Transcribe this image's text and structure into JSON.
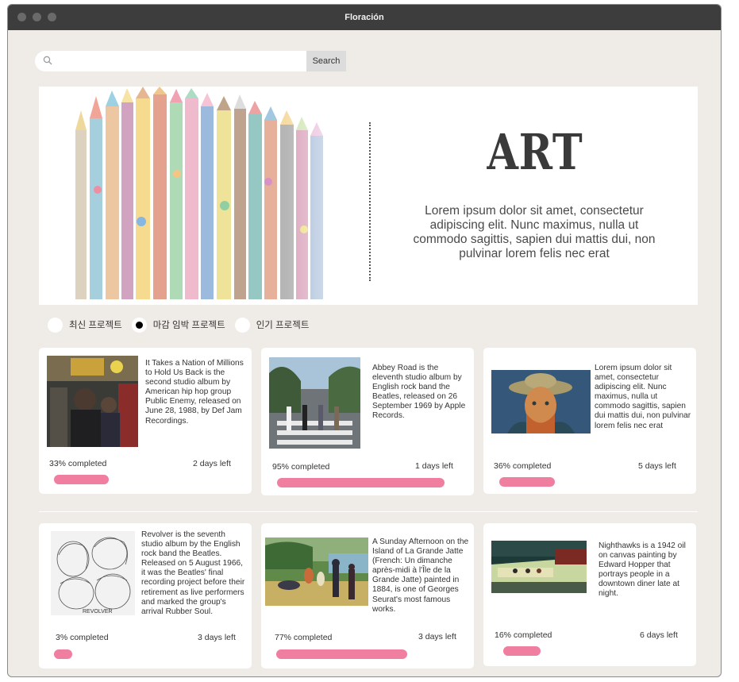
{
  "window": {
    "title": "Floración"
  },
  "search": {
    "placeholder": "",
    "button_label": "Search"
  },
  "hero": {
    "title": "ART",
    "text": "Lorem ipsum dolor sit amet, consectetur adipiscing elit. Nunc maximus, nulla ut commodo sagittis, sapien dui mattis dui, non pulvinar lorem felis nec erat"
  },
  "filters": [
    {
      "label": "최신 프로젝트",
      "checked": false
    },
    {
      "label": "마감 임박 프로젝트",
      "checked": true
    },
    {
      "label": "인기 프로젝트",
      "checked": false
    }
  ],
  "cards": [
    {
      "description": "It Takes a Nation of Millions to Hold Us Back is the second studio album by American hip hop group Public Enemy, released on June 28, 1988, by Def Jam Recordings.",
      "completed_label": "33% completed",
      "progress": 0.33,
      "days_left": "2 days left",
      "image": "album-cover-public-enemy"
    },
    {
      "description": "Abbey Road is the eleventh studio album by English rock band the Beatles, released on 26 September 1969 by Apple Records.",
      "completed_label": "95% completed",
      "progress": 0.95,
      "days_left": "1 days left",
      "image": "album-cover-abbey-road"
    },
    {
      "description": "Lorem ipsum dolor sit amet, consectetur adipiscing elit. Nunc maximus, nulla ut commodo sagittis, sapien dui mattis dui, non pulvinar lorem felis nec erat",
      "completed_label": "36% completed",
      "progress": 0.36,
      "days_left": "5 days left",
      "image": "painting-van-gogh-self-portrait"
    },
    {
      "description": "Revolver is the seventh studio album by the English rock band the Beatles. Released on 5 August 1966, it was the Beatles' final recording project before their retirement as live performers and marked the group's arrival Rubber Soul.",
      "completed_label": "3% completed",
      "progress": 0.03,
      "days_left": "3 days left",
      "image": "album-cover-revolver",
      "cover_text": "REVOLVER"
    },
    {
      "description": "A Sunday Afternoon on the Island of La Grande Jatte (French: Un dimanche après-midi à l'Île de la Grande Jatte) painted in 1884, is one of Georges Seurat's most famous works.",
      "completed_label": "77% completed",
      "progress": 0.77,
      "days_left": "3 days left",
      "image": "painting-grande-jatte"
    },
    {
      "description": "Nighthawks is a 1942 oil on canvas painting by Edward Hopper that portrays people in a downtown diner late at night.",
      "completed_label": "16% completed",
      "progress": 0.16,
      "days_left": "6 days left",
      "image": "painting-nighthawks"
    }
  ],
  "colors": {
    "accent": "#f07ea0",
    "background": "#efebe6",
    "titlebar": "#3d3d3d"
  }
}
